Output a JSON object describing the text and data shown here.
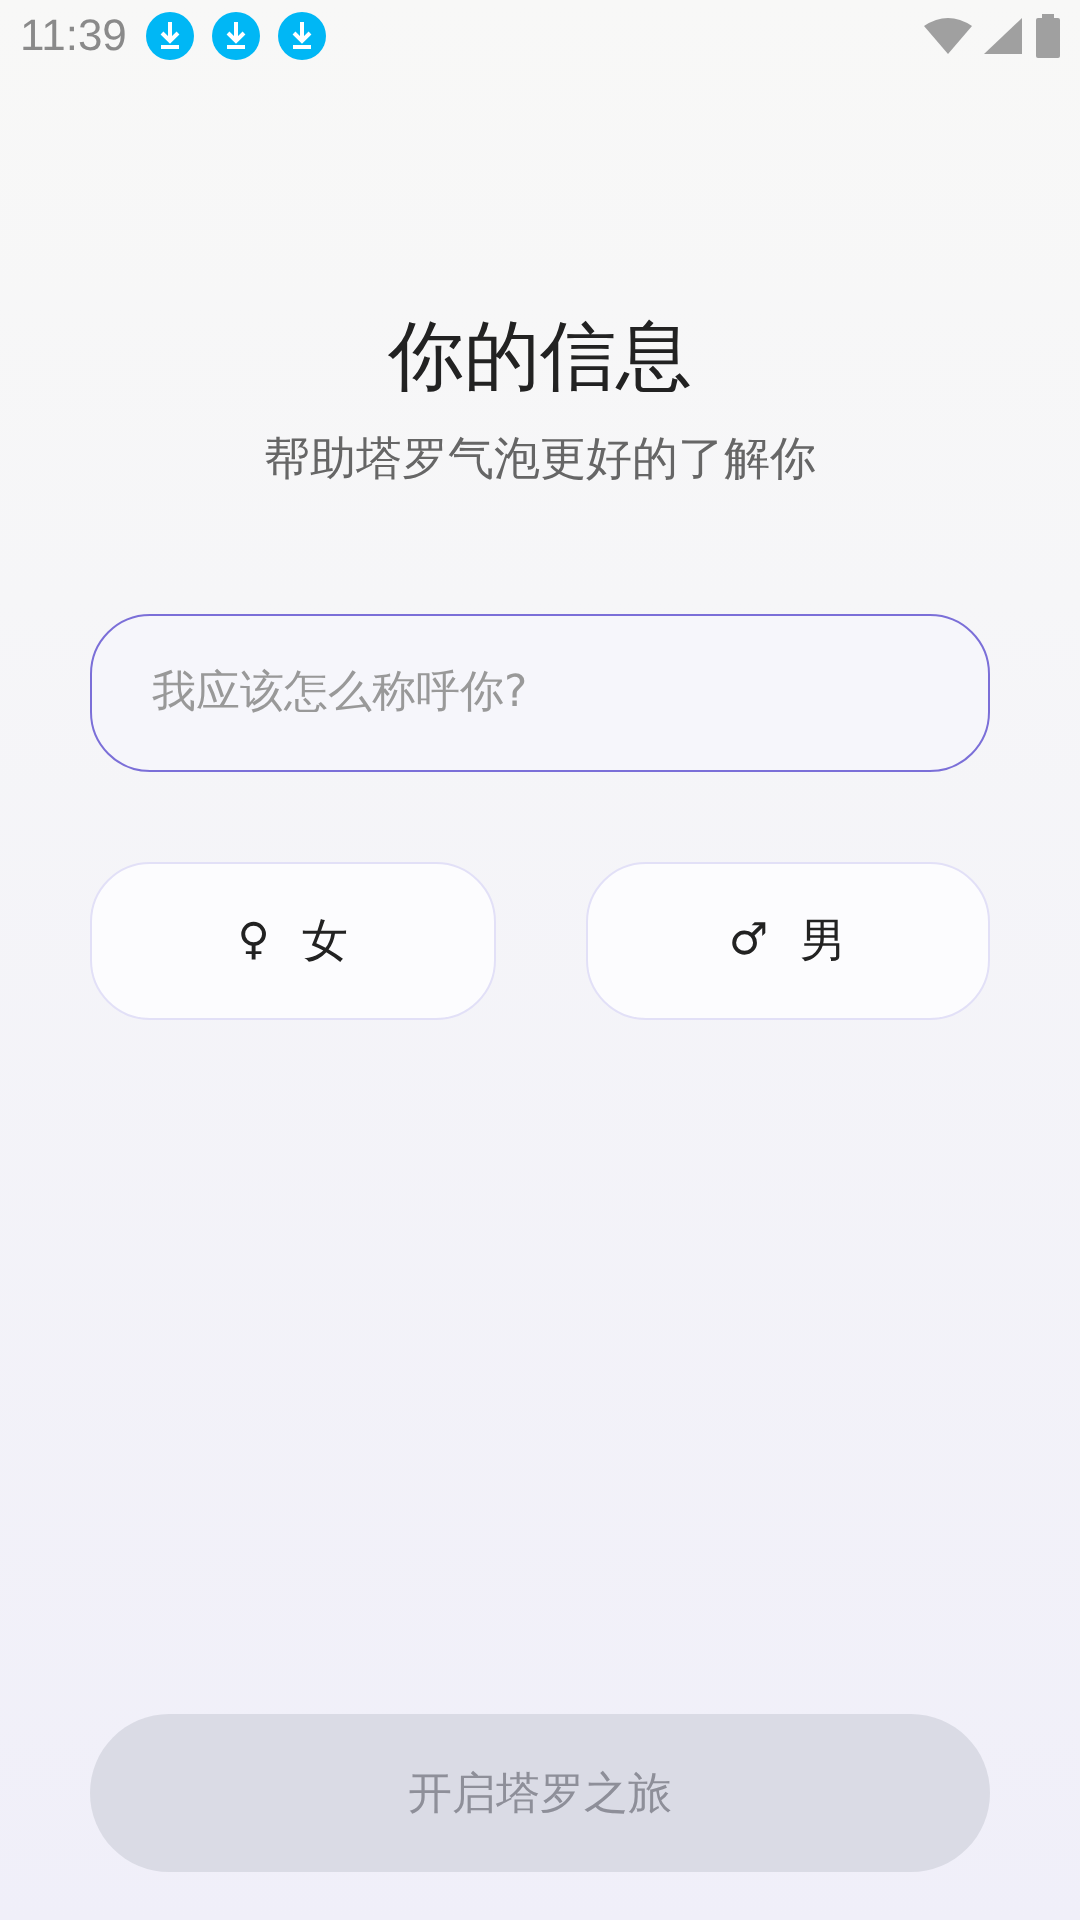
{
  "status_bar": {
    "time": "11:39",
    "notifications": [
      {
        "kind": "download"
      },
      {
        "kind": "download"
      },
      {
        "kind": "download"
      }
    ]
  },
  "title": "你的信息",
  "subtitle": "帮助塔罗气泡更好的了解你",
  "name_field": {
    "placeholder": "我应该怎么称呼你?",
    "focused": true
  },
  "gender_options": [
    {
      "symbol": "♀",
      "label": "女",
      "selected": false
    },
    {
      "symbol": "♂",
      "label": "男",
      "selected": false
    }
  ],
  "start_button": {
    "label": "开启塔罗之旅",
    "disabled": true
  }
}
